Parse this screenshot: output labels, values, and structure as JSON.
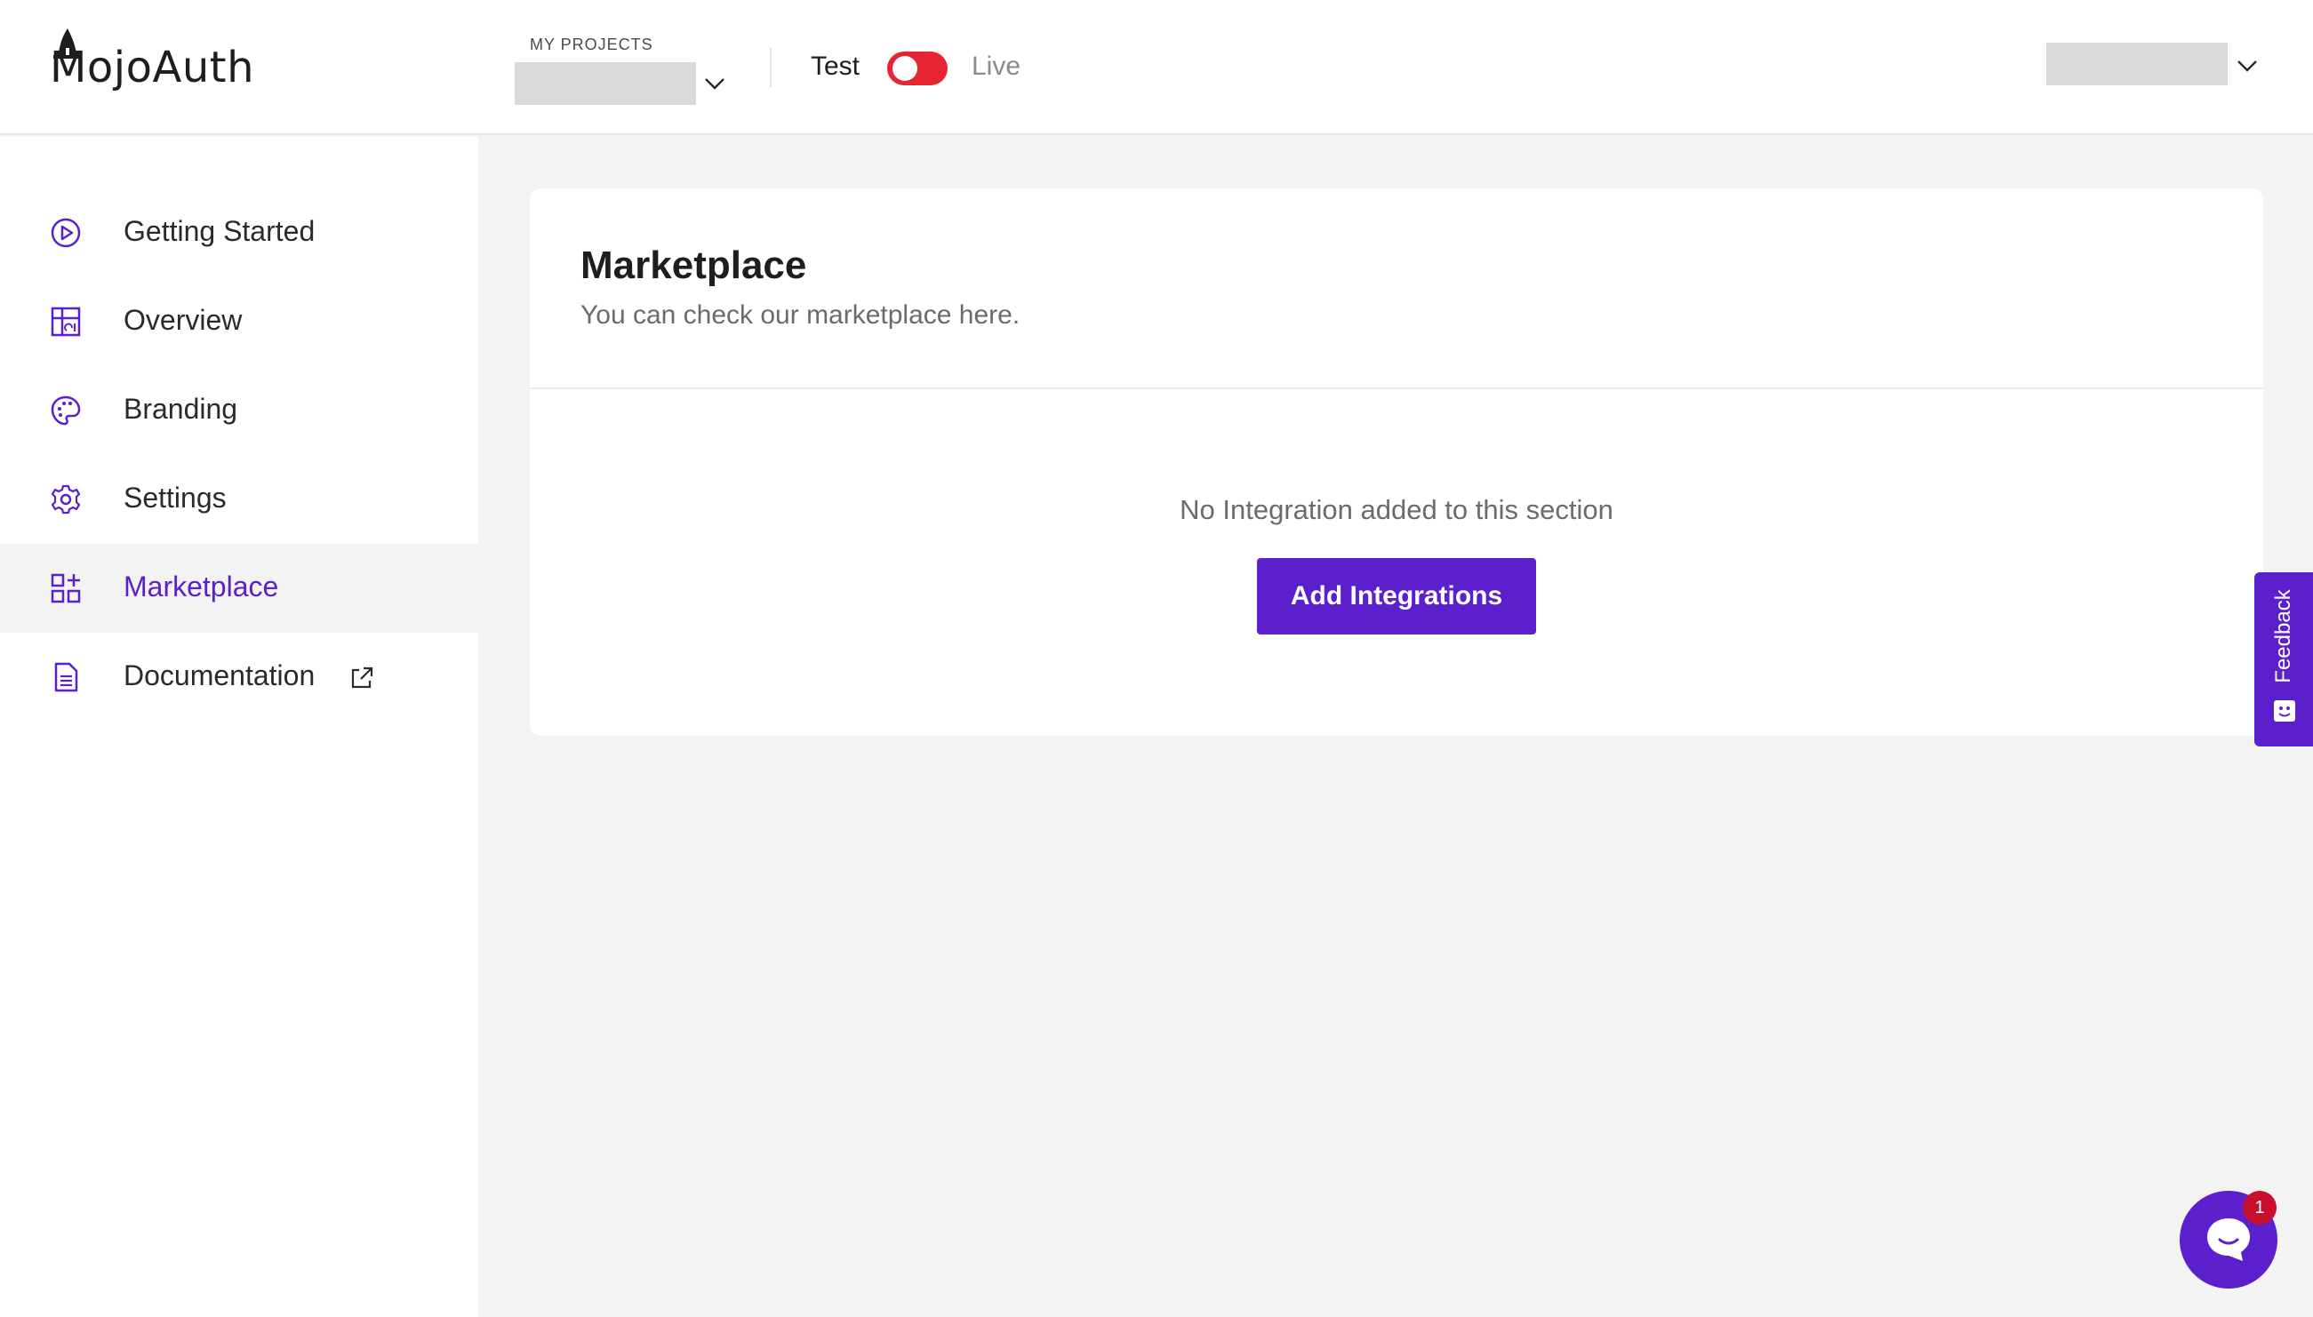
{
  "header": {
    "logo_text": "MojoAuth",
    "projects_label": "MY PROJECTS",
    "mode_test_label": "Test",
    "mode_live_label": "Live",
    "mode_toggle_state": "test",
    "accent_color": "#5b1fcc",
    "toggle_color": "#e52532"
  },
  "sidebar": {
    "items": [
      {
        "label": "Getting Started",
        "icon": "play-circle-icon",
        "active": false
      },
      {
        "label": "Overview",
        "icon": "dashboard-icon",
        "active": false
      },
      {
        "label": "Branding",
        "icon": "palette-icon",
        "active": false
      },
      {
        "label": "Settings",
        "icon": "gear-icon",
        "active": false
      },
      {
        "label": "Marketplace",
        "icon": "apps-add-icon",
        "active": true
      },
      {
        "label": "Documentation",
        "icon": "document-icon",
        "active": false,
        "external": true
      }
    ]
  },
  "main": {
    "title": "Marketplace",
    "subtitle": "You can check our marketplace here.",
    "empty_message": "No Integration added to this section",
    "add_button_label": "Add Integrations"
  },
  "feedback": {
    "label": "Feedback"
  },
  "chat": {
    "badge_count": "1"
  }
}
